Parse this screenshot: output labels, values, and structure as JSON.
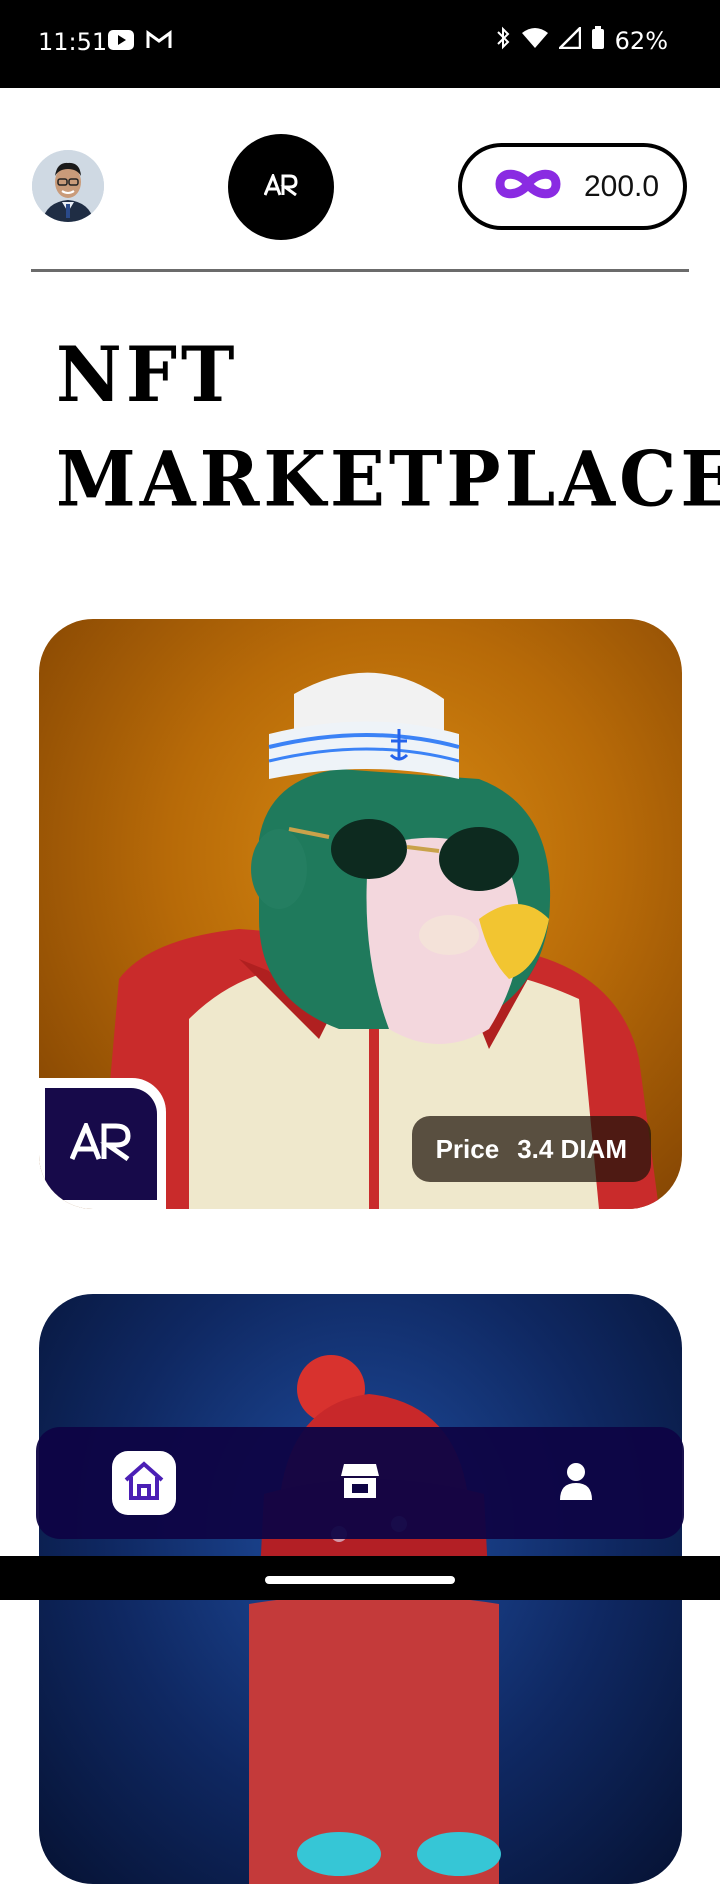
{
  "status_bar": {
    "time": "11:51",
    "battery": "62%",
    "left_icons": [
      "youtube-icon",
      "gmail-icon"
    ],
    "right_icons": [
      "bluetooth-icon",
      "wifi-icon",
      "signal-icon",
      "battery-icon"
    ]
  },
  "header": {
    "logo_text": "AR",
    "balance": "200.0",
    "balance_icon": "infinity-icon",
    "accent_color": "#8a2be2"
  },
  "page": {
    "title_line1": "NFT",
    "title_line2": "MARKETPLACE"
  },
  "cards": [
    {
      "price_label": "Price",
      "price_value": "3.4 DIAM",
      "badge_text": "AR"
    },
    {
      "price_label": "",
      "price_value": "",
      "badge_text": ""
    }
  ],
  "bottom_nav": {
    "items": [
      {
        "name": "home",
        "icon": "home-icon",
        "active": true
      },
      {
        "name": "market",
        "icon": "store-icon",
        "active": false
      },
      {
        "name": "profile",
        "icon": "user-icon",
        "active": false
      }
    ],
    "background": "#0e0444"
  }
}
